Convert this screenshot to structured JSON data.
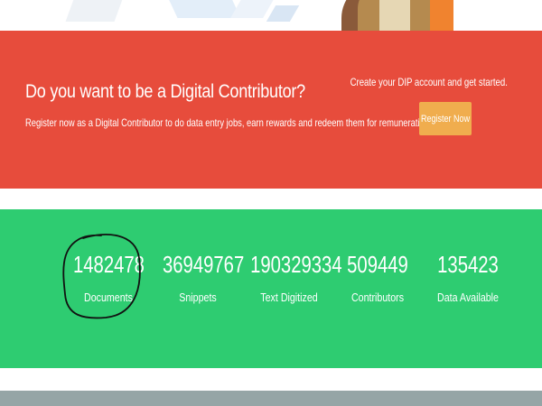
{
  "banner": {
    "title": "Do you want to be a Digital Contributor?",
    "subtitle": "Register now as a Digital Contributor to do data entry jobs, earn rewards and redeem them for remuneration.",
    "cta_text": "Create your DIP account and get started.",
    "register_label": "Register Now"
  },
  "stats": [
    {
      "value": "1482478",
      "label": "Documents"
    },
    {
      "value": "36949767",
      "label": "Snippets"
    },
    {
      "value": "190329334",
      "label": "Text Digitized"
    },
    {
      "value": "509449",
      "label": "Contributors"
    },
    {
      "value": "135423",
      "label": "Data Available"
    }
  ],
  "colors": {
    "banner_red": "#e74c3c",
    "button_orange": "#f0ad4e",
    "stats_green": "#2ecc71",
    "footer_gray": "#95a5a6",
    "text_white": "#ffffff"
  }
}
